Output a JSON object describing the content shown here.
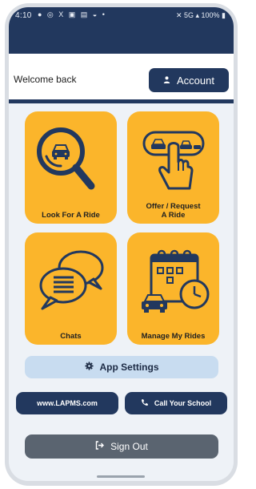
{
  "status_bar": {
    "time": "4:10",
    "left_icons": "● ◎ X ▣ ▤ ◒ •",
    "right_status": "✕ 5G ▴ 100% ▮"
  },
  "header": {
    "welcome": "Welcome back",
    "account_label": "Account",
    "account_icon": "person-icon"
  },
  "tiles": [
    {
      "label": "Look For A Ride",
      "icon": "search-car-icon"
    },
    {
      "label_lines": [
        "Offer / Request",
        "A Ride"
      ],
      "icon": "tap-cars-icon"
    },
    {
      "label": "Chats",
      "icon": "chat-bubbles-icon"
    },
    {
      "label": "Manage My Rides",
      "icon": "calendar-car-icon"
    }
  ],
  "buttons": {
    "settings": "App Settings",
    "website": "www.LAPMS.com",
    "call": "Call Your School",
    "signout": "Sign Out"
  },
  "colors": {
    "navy": "#22385e",
    "tile": "#fbb52b",
    "settings_bg": "#c8dcf0",
    "signout_bg": "#5a6470",
    "screen_bg": "#eef2f7"
  }
}
